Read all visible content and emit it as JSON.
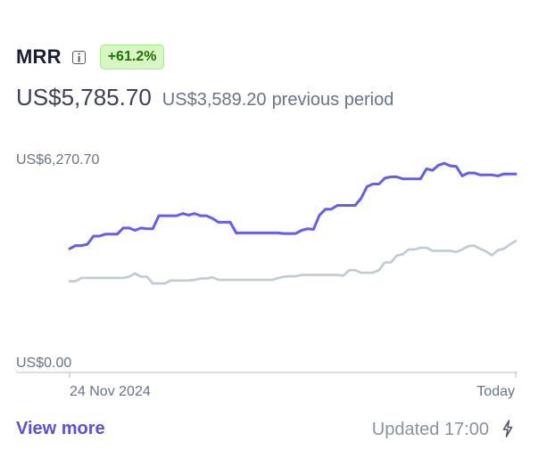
{
  "metric": {
    "title": "MRR",
    "info_icon": "info-icon",
    "change_badge": "+61.2%",
    "current_value": "US$5,785.70",
    "previous_value": "US$3,589.20",
    "previous_label": "previous period"
  },
  "chart_data": {
    "type": "line",
    "ylim": [
      0,
      6270.7
    ],
    "y_tick_labels": [
      "US$6,270.70",
      "US$0.00"
    ],
    "x_tick_labels": [
      "24 Nov 2024",
      "Today"
    ],
    "series": [
      {
        "color": "#635bff",
        "values": [
          3460,
          3560,
          3560,
          3600,
          3850,
          3850,
          3910,
          3910,
          3910,
          4100,
          4100,
          4030,
          4100,
          4080,
          4080,
          4480,
          4480,
          4480,
          4480,
          4550,
          4500,
          4550,
          4480,
          4480,
          4400,
          4280,
          4280,
          4280,
          3950,
          3950,
          3950,
          3950,
          3950,
          3950,
          3950,
          3950,
          3930,
          3930,
          3930,
          4030,
          4080,
          4060,
          4500,
          4680,
          4680,
          4800,
          4800,
          4800,
          4800,
          5020,
          5380,
          5460,
          5460,
          5640,
          5680,
          5680,
          5620,
          5620,
          5620,
          5620,
          5930,
          5880,
          6040,
          6100,
          6020,
          6000,
          5710,
          5800,
          5800,
          5740,
          5740,
          5740,
          5710,
          5770,
          5770,
          5770
        ]
      },
      {
        "color": "#c1c9d2",
        "values": [
          2460,
          2460,
          2560,
          2560,
          2560,
          2560,
          2560,
          2560,
          2560,
          2560,
          2600,
          2700,
          2600,
          2600,
          2390,
          2390,
          2390,
          2480,
          2480,
          2480,
          2480,
          2500,
          2540,
          2540,
          2580,
          2500,
          2500,
          2500,
          2500,
          2500,
          2500,
          2500,
          2500,
          2500,
          2500,
          2550,
          2600,
          2610,
          2610,
          2650,
          2650,
          2650,
          2650,
          2650,
          2650,
          2650,
          2630,
          2800,
          2800,
          2720,
          2720,
          2720,
          2800,
          3040,
          3040,
          3250,
          3290,
          3440,
          3440,
          3490,
          3490,
          3400,
          3400,
          3400,
          3400,
          3360,
          3440,
          3540,
          3560,
          3460,
          3380,
          3260,
          3420,
          3460,
          3590,
          3700
        ]
      }
    ]
  },
  "footer": {
    "view_more_label": "View more",
    "updated_text": "Updated 17:00",
    "bolt_icon": "lightning-bolt-icon"
  }
}
